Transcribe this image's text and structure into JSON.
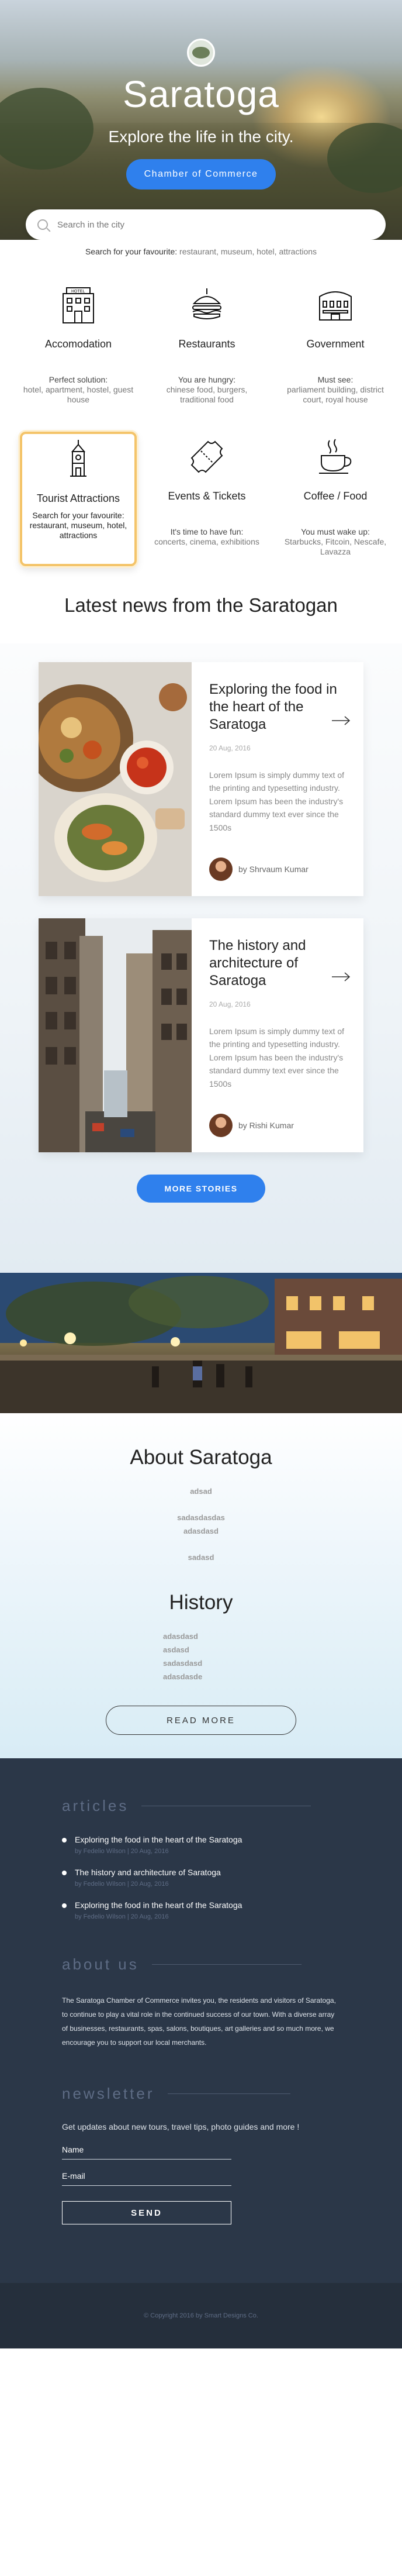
{
  "hero": {
    "title": "Saratoga",
    "subtitle": "Explore the life in the city.",
    "cta_label": "Chamber of Commerce",
    "search_placeholder": "Search in the city"
  },
  "search_hint": {
    "label": "Search for your favourite:",
    "options": "restaurant, museum, hotel, attractions"
  },
  "categories": [
    {
      "title": "Accomodation",
      "desc": "Perfect solution:",
      "desc_sm": "hotel, apartment, hostel, guest house",
      "icon": "hotel-icon"
    },
    {
      "title": "Restaurants",
      "desc": "You are hungry:",
      "desc_sm": "chinese food, burgers, traditional food",
      "icon": "burger-icon"
    },
    {
      "title": "Government",
      "desc": "Must see:",
      "desc_sm": "parliament building, district court, royal house",
      "icon": "government-building-icon"
    },
    {
      "title": "Tourist Attractions",
      "desc": "Search for your favourite: restaurant, museum, hotel, attractions",
      "desc_sm": "",
      "icon": "tower-icon"
    },
    {
      "title": "Events & Tickets",
      "desc": "It's time to have fun:",
      "desc_sm": "concerts, cinema, exhibitions",
      "icon": "ticket-icon"
    },
    {
      "title": "Coffee / Food",
      "desc": "You must wake up:",
      "desc_sm": "Starbucks, Fitcoin, Nescafe, Lavazza",
      "icon": "coffee-cup-icon"
    }
  ],
  "news": {
    "heading": "Latest news from the Saratogan",
    "articles": [
      {
        "title": "Exploring the food in the heart of the Saratoga",
        "date": "20 Aug, 2016",
        "body": "Lorem Ipsum is simply dummy text of the printing and typesetting industry. Lorem Ipsum has been the industry's standard dummy text ever since the 1500s",
        "author": "by Shrvaum Kumar"
      },
      {
        "title": "The history and architecture of Saratoga",
        "date": "20 Aug, 2016",
        "body": "Lorem Ipsum is simply dummy text of the printing and typesetting industry. Lorem Ipsum has been the industry's standard dummy text ever since the 1500s",
        "author": "by Rishi  Kumar"
      }
    ],
    "more_label": "MORE STORIES"
  },
  "about": {
    "title": "About Saratoga",
    "lines": [
      "adsad",
      "sadasdasdas",
      "adasdasd",
      "sadasd"
    ],
    "history_title": "History",
    "history_lines": [
      "adasdasd",
      "asdasd",
      "sadasdasd",
      "adasdasde"
    ],
    "read_more": "READ MORE"
  },
  "footer": {
    "articles_title": "articles",
    "articles": [
      {
        "title": "Exploring the food in the heart of the Saratoga",
        "meta": "by Fedelio Wilson   |   20 Aug, 2016"
      },
      {
        "title": "The history and architecture of Saratoga",
        "meta": "by Fedelio Wilson   |   20 Aug, 2016"
      },
      {
        "title": "Exploring the food in the heart of the Saratoga",
        "meta": "by Fedelio Wilson   |   20 Aug, 2016"
      }
    ],
    "about_title": "about us",
    "about_text": "The Saratoga Chamber of Commerce invites you, the residents and visitors of Saratoga, to continue to play a vital role in the continued success of our town. With a diverse array of businesses, restaurants, spas, salons, boutiques, art galleries and so much more, we encourage you to support our local merchants.",
    "newsletter_title": "newsletter",
    "newsletter_text": "Get updates about new tours, travel tips, photo guides and more !",
    "name_placeholder": "Name",
    "email_placeholder": "E-mail",
    "send_label": "SEND",
    "copyright": "© Copyright 2016  by Smart Designs Co."
  },
  "colors": {
    "accent": "#2f80ed",
    "highlight_border": "#f4c46a",
    "footer_bg": "#2b3748",
    "footer_muted": "#5e6c85"
  }
}
